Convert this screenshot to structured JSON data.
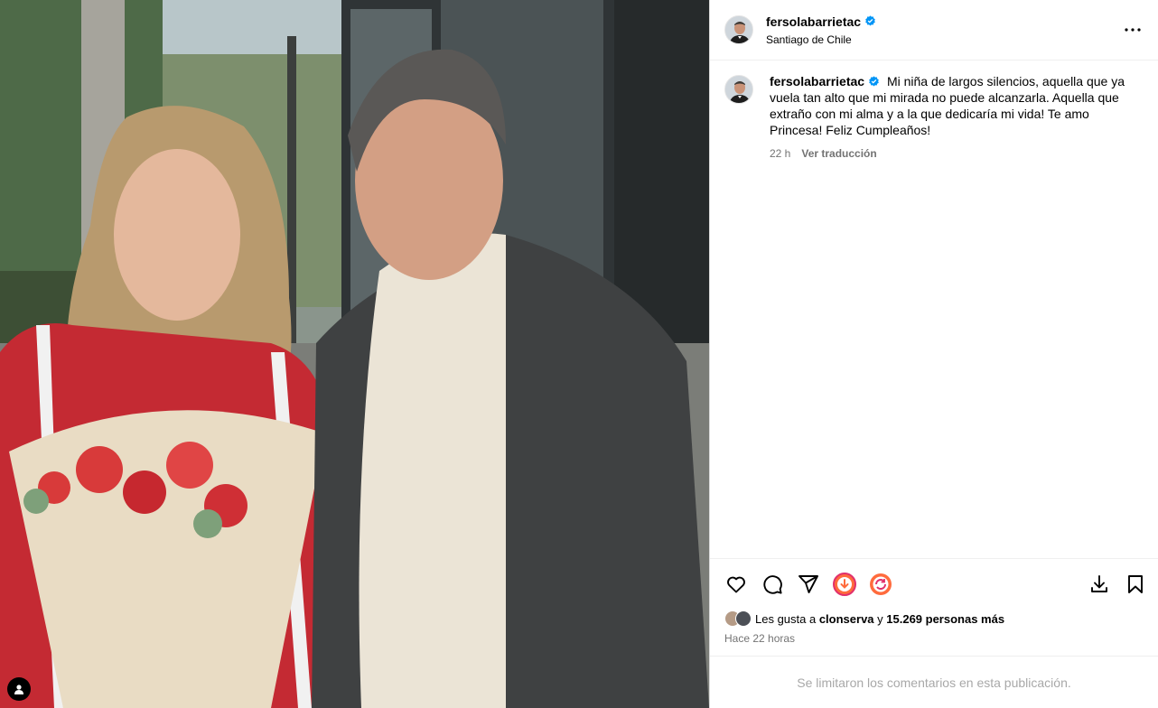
{
  "header": {
    "username": "fersolabarrietac",
    "location": "Santiago de Chile",
    "more_icon": "more-horizontal-icon"
  },
  "caption": {
    "username": "fersolabarrietac",
    "text": "Mi niña de largos silencios, aquella que ya vuela tan alto que mi mirada no puede alcanzarla. Aquella que extraño con mi alma y a la que dedicaría mi vida! Te amo Princesa! Feliz Cumpleaños!",
    "age": "22 h",
    "translate_label": "Ver traducción"
  },
  "actions": {
    "icons": [
      "heart-icon",
      "comment-icon",
      "share-icon",
      "download-extension-icon",
      "refresh-extension-icon",
      "download-icon",
      "bookmark-icon"
    ]
  },
  "likes": {
    "prefix": "Les gusta a ",
    "user": "clonserva",
    "connector": " y ",
    "count": "15.269 personas más"
  },
  "timestamp": "Hace 22 horas",
  "comments_limited": "Se limitaron los comentarios en esta publicación.",
  "colors": {
    "verified": "#0095f6",
    "secondary_text": "#737373",
    "muted_text": "#a8a8a8",
    "ext_orange": "#ff6b3d",
    "ext_pink": "#e1306c"
  }
}
